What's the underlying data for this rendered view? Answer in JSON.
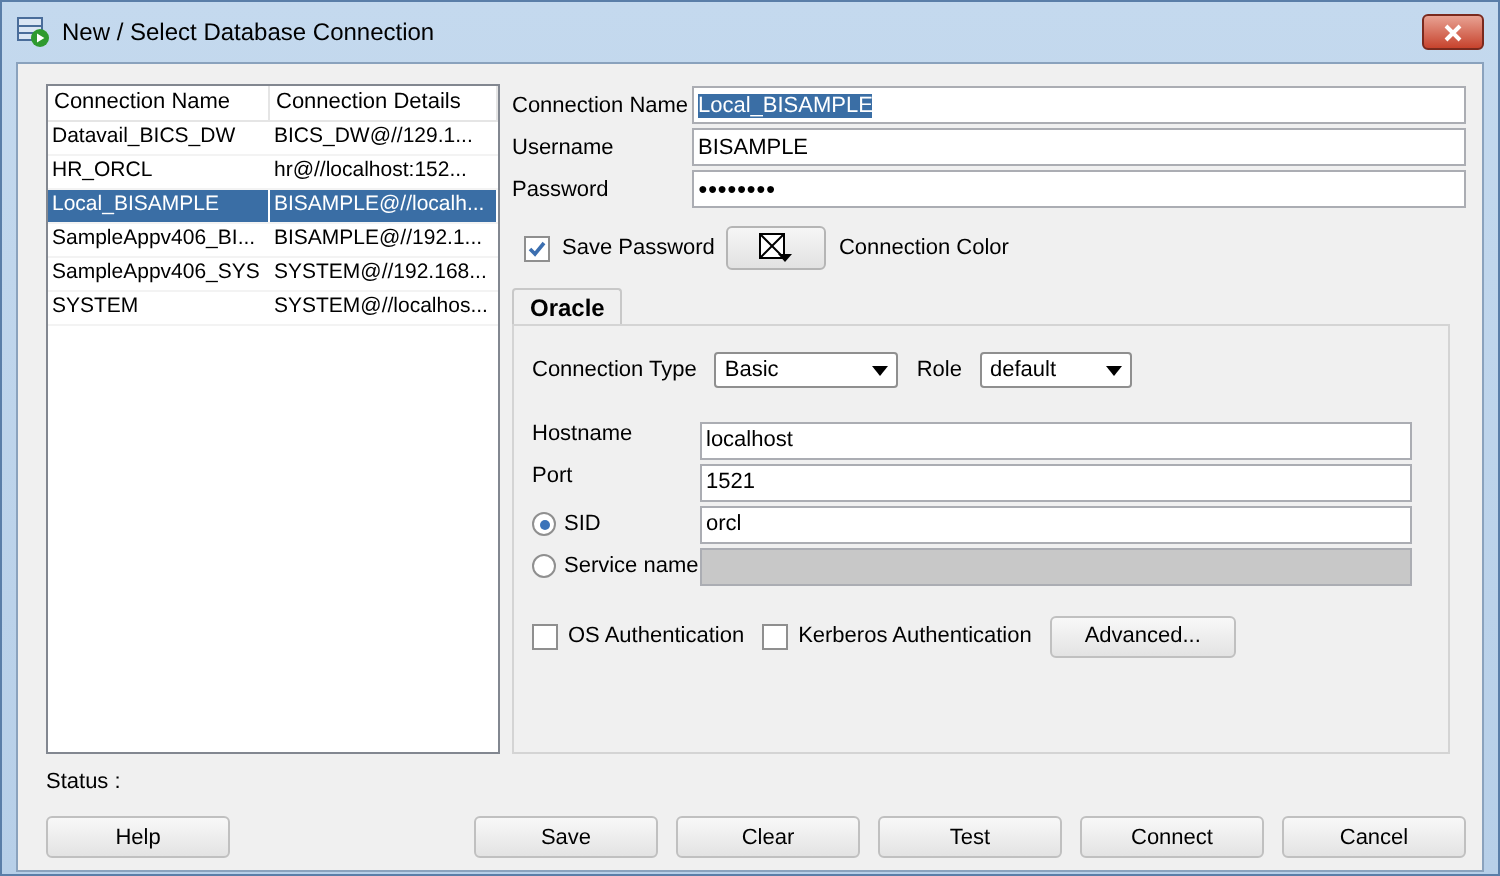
{
  "window": {
    "title": "New / Select Database Connection"
  },
  "connections": {
    "columns": [
      "Connection Name",
      "Connection Details"
    ],
    "rows": [
      {
        "name": "Datavail_BICS_DW",
        "details": "BICS_DW@//129.1...",
        "selected": false
      },
      {
        "name": "HR_ORCL",
        "details": "hr@//localhost:152...",
        "selected": false
      },
      {
        "name": "Local_BISAMPLE",
        "details": "BISAMPLE@//localh...",
        "selected": true
      },
      {
        "name": "SampleAppv406_BI...",
        "details": "BISAMPLE@//192.1...",
        "selected": false
      },
      {
        "name": "SampleAppv406_SYS",
        "details": "SYSTEM@//192.168...",
        "selected": false
      },
      {
        "name": "SYSTEM",
        "details": "SYSTEM@//localhos...",
        "selected": false
      }
    ]
  },
  "fields": [
    {
      "label": "Connection Name",
      "value": "Local_BISAMPLE",
      "kind": "text",
      "highlighted": true
    },
    {
      "label": "Username",
      "value": "BISAMPLE",
      "kind": "text",
      "highlighted": false
    },
    {
      "label": "Password",
      "value": "●●●●●●●●",
      "kind": "password",
      "highlighted": false
    }
  ],
  "save_password": {
    "label": "Save Password",
    "checked": true
  },
  "connection_color": {
    "label": "Connection Color"
  },
  "tabs": [
    {
      "label": "Oracle",
      "selected": true
    }
  ],
  "connection_type": {
    "label": "Connection Type",
    "value": "Basic"
  },
  "role": {
    "label": "Role",
    "value": "default"
  },
  "details": [
    {
      "kind": "label",
      "label": "Hostname",
      "value": "localhost",
      "disabled": false
    },
    {
      "kind": "label",
      "label": "Port",
      "value": "1521",
      "disabled": false
    },
    {
      "kind": "radio",
      "label": "SID",
      "value": "orcl",
      "selected": true,
      "disabled": false
    },
    {
      "kind": "radio",
      "label": "Service name",
      "selected": false,
      "disabled": true
    }
  ],
  "auth": [
    {
      "label": "OS Authentication",
      "checked": false
    },
    {
      "label": "Kerberos Authentication",
      "checked": false
    }
  ],
  "advanced_button": "Advanced...",
  "status": {
    "label": "Status :"
  },
  "buttons": [
    {
      "label": "Help",
      "kind": "left"
    },
    {
      "label": "Save",
      "kind": "right"
    },
    {
      "label": "Clear",
      "kind": "right"
    },
    {
      "label": "Test",
      "kind": "right"
    },
    {
      "label": "Connect",
      "kind": "right"
    },
    {
      "label": "Cancel",
      "kind": "right"
    }
  ]
}
